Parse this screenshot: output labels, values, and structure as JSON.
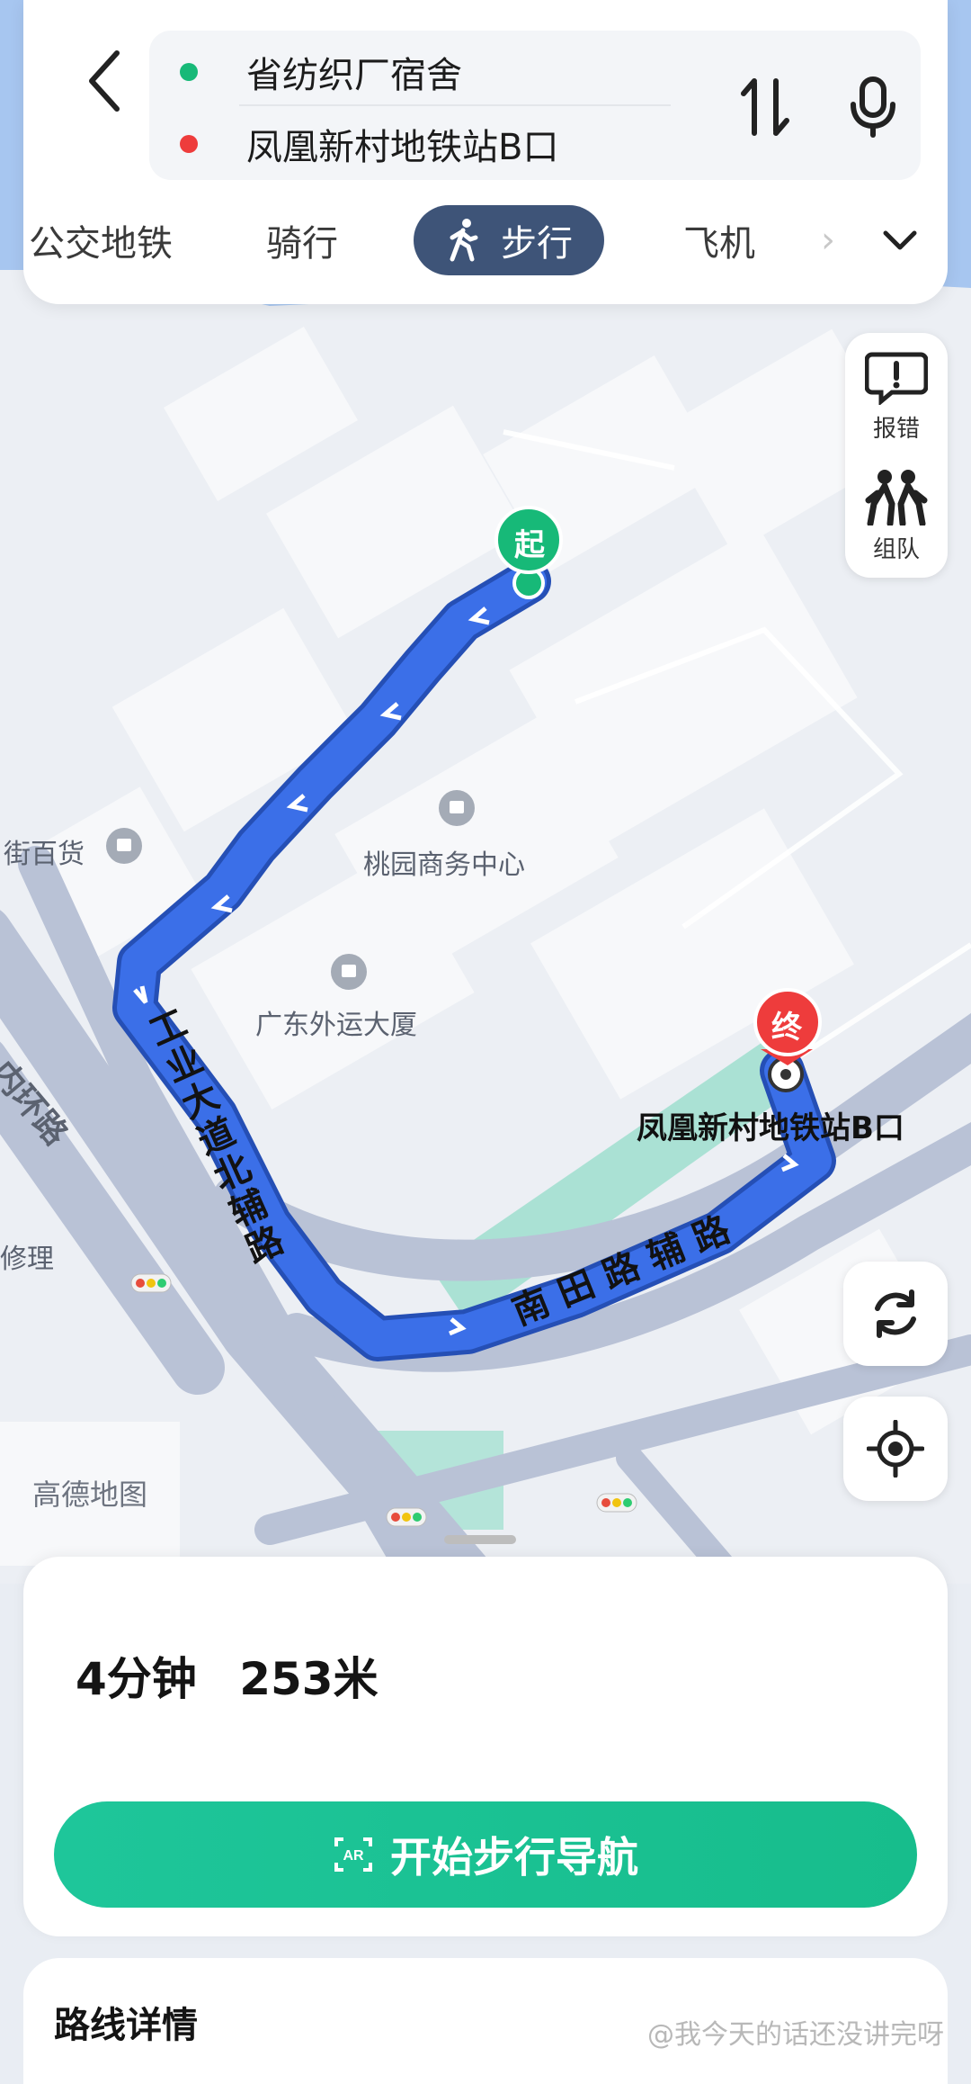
{
  "route": {
    "origin": "省纺织厂宿舍",
    "destination": "凤凰新村地铁站B口"
  },
  "modes": [
    {
      "label": "公交地铁",
      "active": false
    },
    {
      "label": "骑行",
      "active": false
    },
    {
      "label": "步行",
      "active": true
    },
    {
      "label": "飞机",
      "active": false
    }
  ],
  "map": {
    "start_marker": "起",
    "end_marker": "终",
    "poi": {
      "store": "街百货",
      "center": "桃园商务中心",
      "building": "广东外运大厦",
      "repair": "修理",
      "destination_label": "凤凰新村地铁站B口"
    },
    "roads": {
      "inner_ring": "内环路",
      "industrial_ave": "工业大道北辅路",
      "nantian": "南田路辅路"
    },
    "logo": "高德地图"
  },
  "side_controls": {
    "report_label": "报错",
    "team_label": "组队"
  },
  "summary": {
    "time": "4分钟",
    "distance": "253米"
  },
  "start_button": "开始步行导航",
  "details_title": "路线详情",
  "watermark": "@我今天的话还没讲完呀",
  "colors": {
    "route": "#3b6fe8",
    "start": "#17b978",
    "end": "#ee3c3c",
    "primary": "#1ec69a",
    "active_tab": "#3e5478"
  }
}
